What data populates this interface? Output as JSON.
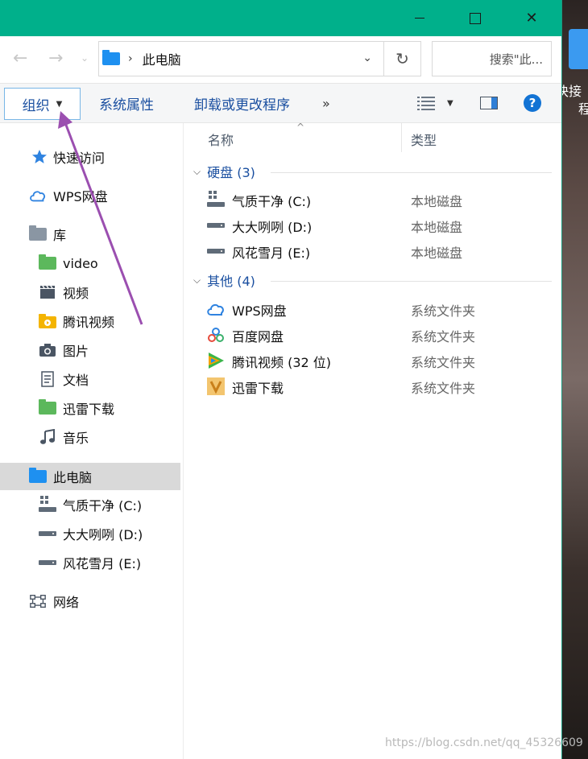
{
  "window": {
    "controls": {
      "minimize": "minimize",
      "maximize": "maximize",
      "close": "✕"
    }
  },
  "address": {
    "path": "此电脑",
    "search_placeholder": "搜索\"此..."
  },
  "commandbar": {
    "organize": "组织",
    "system_properties": "系统属性",
    "uninstall": "卸载或更改程序",
    "more": "»"
  },
  "sidebar": {
    "quick_access": "快速访问",
    "wps_cloud": "WPS网盘",
    "library": "库",
    "library_items": [
      "video",
      "视频",
      "腾讯视频",
      "图片",
      "文档",
      "迅雷下载",
      "音乐"
    ],
    "this_pc": "此电脑",
    "drives": [
      "气质干净 (C:)",
      "大大咧咧 (D:)",
      "风花雪月 (E:)"
    ],
    "network": "网络"
  },
  "columns": {
    "name": "名称",
    "type": "类型"
  },
  "groups": [
    {
      "label": "硬盘 (3)",
      "items": [
        {
          "name": "气质干净 (C:)",
          "type": "本地磁盘"
        },
        {
          "name": "大大咧咧 (D:)",
          "type": "本地磁盘"
        },
        {
          "name": "风花雪月 (E:)",
          "type": "本地磁盘"
        }
      ]
    },
    {
      "label": "其他 (4)",
      "items": [
        {
          "name": "WPS网盘",
          "type": "系统文件夹"
        },
        {
          "name": "百度网盘",
          "type": "系统文件夹"
        },
        {
          "name": "腾讯视频 (32 位)",
          "type": "系统文件夹"
        },
        {
          "name": "迅雷下载",
          "type": "系统文件夹"
        }
      ]
    }
  ],
  "background": {
    "text1": "快接",
    "text2": "程"
  },
  "watermark": "https://blog.csdn.net/qq_45326609",
  "colors": {
    "titlebar": "#00b08b",
    "accent": "#1a4fa0",
    "arrow": "#9b4fb0",
    "selected": "#d9d9d9"
  }
}
